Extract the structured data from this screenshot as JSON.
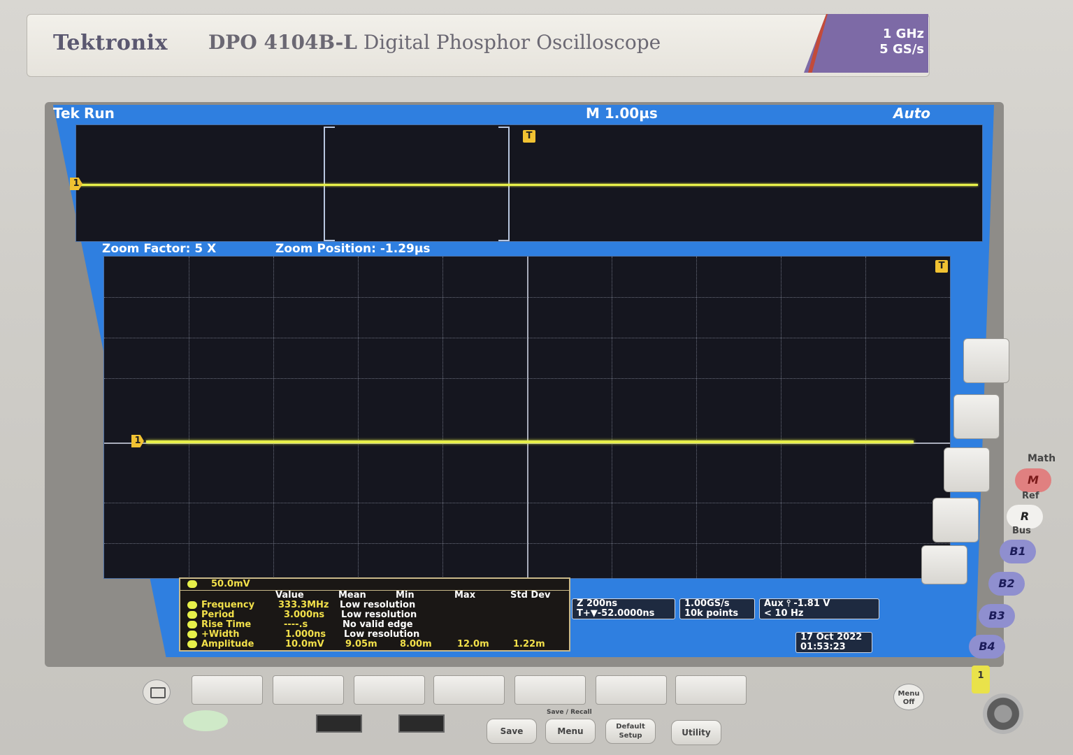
{
  "front_panel": {
    "brand": "Tektronix",
    "model": "DPO 4104B-L",
    "description": "Digital Phosphor Oscilloscope",
    "spec_bandwidth": "1 GHz",
    "spec_sample_rate": "5 GS/s"
  },
  "status_bar": {
    "tek": "Tek",
    "run_state": "Run",
    "main_timebase": "M 1.00µs",
    "trigger_mode": "Auto"
  },
  "zoom": {
    "factor": "Zoom Factor: 5 X",
    "position": "Zoom Position: -1.29µs"
  },
  "markers": {
    "trigger": "T",
    "channel1": "1"
  },
  "channel1": {
    "scale": "50.0mV"
  },
  "measurements": {
    "columns": [
      "Value",
      "Mean",
      "Min",
      "Max",
      "Std Dev"
    ],
    "rows": [
      {
        "name": "Frequency",
        "value": "333.3MHz",
        "stat": "Low resolution"
      },
      {
        "name": "Period",
        "value": "3.000ns",
        "stat": "Low resolution"
      },
      {
        "name": "Rise Time",
        "value": "----.s",
        "stat": "No valid edge"
      },
      {
        "name": "+Width",
        "value": "1.000ns",
        "stat": "Low resolution"
      },
      {
        "name": "Amplitude",
        "value": "10.0mV",
        "mean": "9.05m",
        "min": "8.00m",
        "max": "12.0m",
        "std": "1.22m"
      }
    ]
  },
  "readouts": {
    "zoom_time": "Z 200ns",
    "trigger_position": "T+▼-52.0000ns",
    "sample_rate": "1.00GS/s",
    "record_length": "10k points",
    "trigger_source": "Aux ⫯ -1.81 V",
    "trigger_freq": "< 10 Hz",
    "date": "17 Oct  2022",
    "time": "01:53:23"
  },
  "panel_buttons": {
    "save": "Save",
    "menu": "Menu",
    "default_setup": "Default Setup",
    "utility": "Utility",
    "save_recall_label": "Save / Recall",
    "menu_off": "Menu Off",
    "math_label": "Math",
    "math": "M",
    "ref_label": "Ref",
    "ref": "R",
    "bus_label": "Bus",
    "b1": "B1",
    "b2": "B2",
    "b3": "B3",
    "b4": "B4",
    "ch1_input": "1"
  },
  "colors": {
    "screen_blue": "#2f7fe0",
    "trace_yellow": "#e7f04a",
    "graticule_bg": "#15161f"
  }
}
